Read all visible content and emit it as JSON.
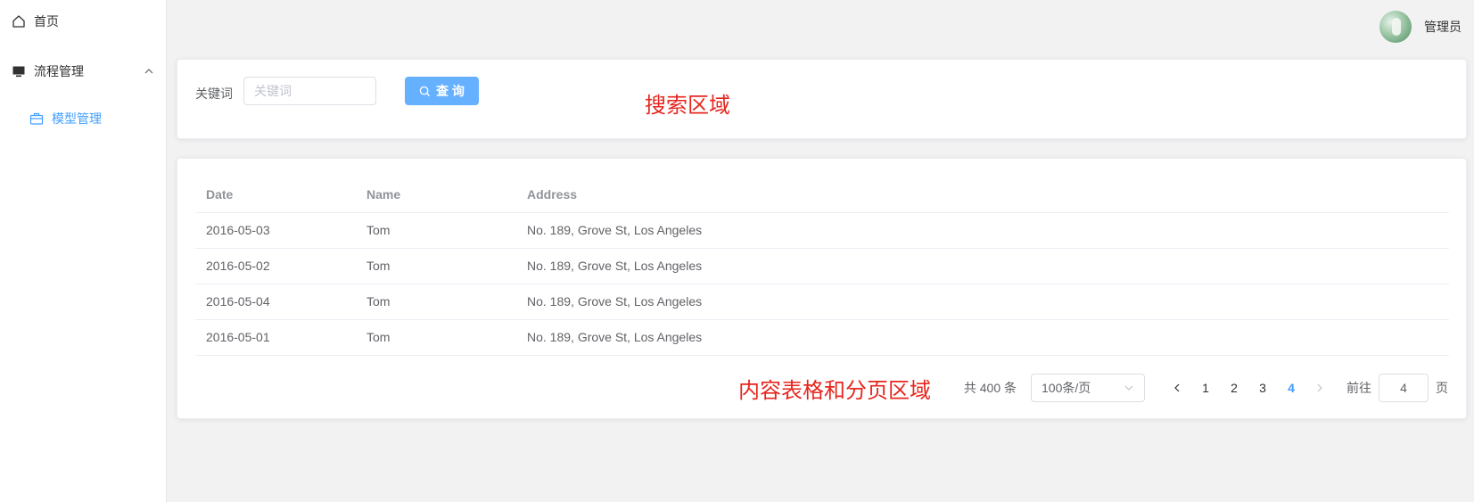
{
  "sidebar": {
    "home_label": "首页",
    "home_icon": "home-icon",
    "flow_label": "流程管理",
    "flow_icon": "monitor-icon",
    "flow_expanded": true,
    "sub_items": [
      {
        "label": "模型管理",
        "icon": "briefcase-icon",
        "active": true
      }
    ]
  },
  "header": {
    "username": "管理员",
    "avatar_icon": "avatar"
  },
  "search": {
    "keyword_label": "关键词",
    "keyword_placeholder": "关键词",
    "keyword_value": "",
    "button_label": "查 询",
    "button_icon": "search-icon",
    "area_annotation": "搜索区域"
  },
  "table": {
    "columns": [
      "Date",
      "Name",
      "Address"
    ],
    "rows": [
      {
        "date": "2016-05-03",
        "name": "Tom",
        "address": "No. 189, Grove St, Los Angeles"
      },
      {
        "date": "2016-05-02",
        "name": "Tom",
        "address": "No. 189, Grove St, Los Angeles"
      },
      {
        "date": "2016-05-04",
        "name": "Tom",
        "address": "No. 189, Grove St, Los Angeles"
      },
      {
        "date": "2016-05-01",
        "name": "Tom",
        "address": "No. 189, Grove St, Los Angeles"
      }
    ]
  },
  "pagination": {
    "area_annotation": "内容表格和分页区域",
    "total_text": "共 400 条",
    "page_size": "100条/页",
    "pages": [
      "1",
      "2",
      "3",
      "4"
    ],
    "current_page": "4",
    "jump_label": "前往",
    "jump_value": "4",
    "jump_unit": "页"
  },
  "colors": {
    "primary": "#409eff",
    "button": "#66b1ff",
    "annotation": "#e6261f"
  }
}
